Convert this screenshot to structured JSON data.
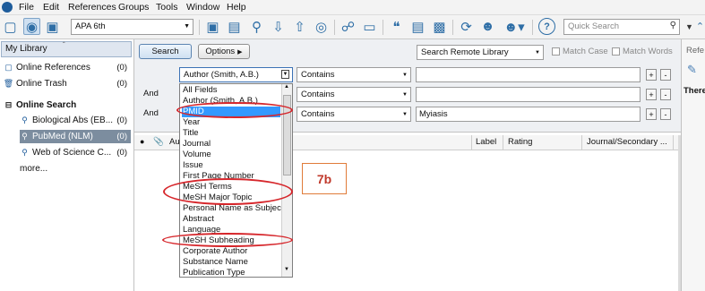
{
  "menubar": {
    "items": [
      "File",
      "Edit",
      "References",
      "Groups",
      "Tools",
      "Window",
      "Help"
    ]
  },
  "toolbar": {
    "style_value": "APA 6th",
    "quick_search_placeholder": "Quick Search",
    "icons": [
      "local-library-icon",
      "online-mode-icon",
      "integrated-library-icon",
      "new-reference-icon",
      "edit-reference-icon",
      "online-search-icon",
      "import-icon",
      "export-icon",
      "find-fulltext-icon",
      "open-link-icon",
      "open-file-icon",
      "insert-citation-icon",
      "format-bibliography-icon",
      "sync-icon",
      "share-icon",
      "share-group-icon",
      "help-icon"
    ]
  },
  "left_pane": {
    "library_label": "My Library",
    "groups": [
      {
        "label": "Online References",
        "count": "(0)"
      },
      {
        "label": "Online Trash",
        "count": "(0)"
      }
    ],
    "online_search_label": "Online Search",
    "online_items": [
      {
        "label": "Biological Abs (EB...",
        "count": "(0)"
      },
      {
        "label": "PubMed (NLM)",
        "count": "(0)"
      },
      {
        "label": "Web of Science C...",
        "count": "(0)"
      }
    ],
    "more_label": "more..."
  },
  "search_panel": {
    "search_label": "Search",
    "options_label": "Options",
    "remote_library_label": "Search Remote Library",
    "match_case_label": "Match Case",
    "match_words_label": "Match Words",
    "rows": [
      {
        "connector": "",
        "field": "Author (Smith, A.B.)",
        "operator": "Contains",
        "value": ""
      },
      {
        "connector": "And",
        "field": "",
        "operator": "Contains",
        "value": ""
      },
      {
        "connector": "And",
        "field": "",
        "operator": "Contains",
        "value": "Myiasis"
      }
    ],
    "plus": "+",
    "minus": "-"
  },
  "grid": {
    "columns": [
      "Au",
      "Label",
      "Rating",
      "Journal/Secondary ..."
    ]
  },
  "right_pane": {
    "header": "Refe",
    "text": "There"
  },
  "dropdown": {
    "items": [
      "All Fields",
      "Author (Smith, A.B.)",
      "PMID",
      "Year",
      "Title",
      "Journal",
      "Volume",
      "Issue",
      "First Page Number",
      "MeSH Terms",
      "MeSH Major Topic",
      "Personal Name as Subject",
      "Abstract",
      "Language",
      "MeSH Subheading",
      "Corporate Author",
      "Substance Name",
      "Publication Type"
    ],
    "highlighted": "PMID"
  },
  "callout": {
    "text": "7b",
    "color": "#d6262b"
  }
}
